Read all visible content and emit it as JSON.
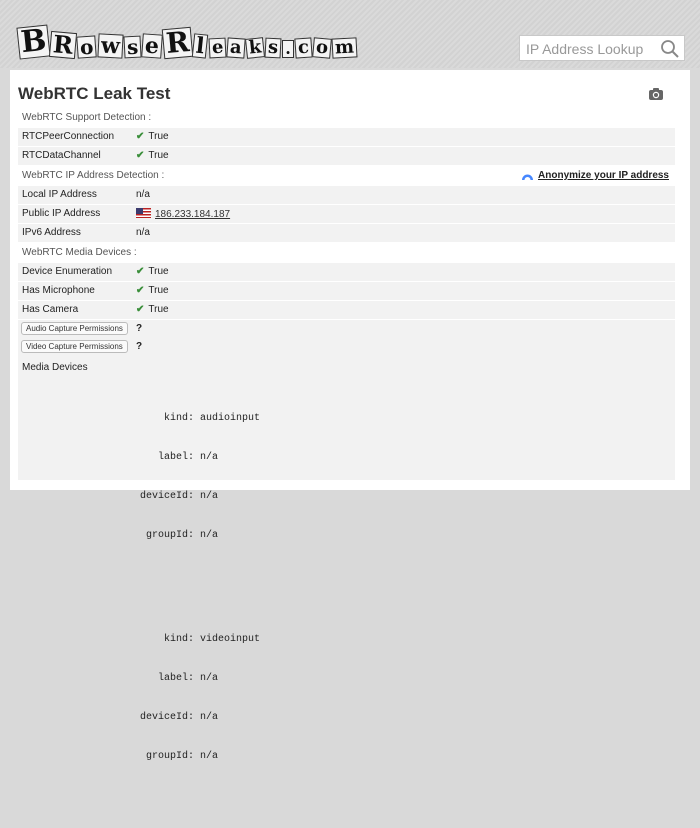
{
  "header": {
    "logo_letters": [
      "B",
      "R",
      "o",
      "w",
      "s",
      "e",
      "R",
      "l",
      "e",
      "a",
      "k",
      "s",
      ".",
      "c",
      "o",
      "m"
    ],
    "search_placeholder": "IP Address Lookup"
  },
  "main": {
    "title": "WebRTC Leak Test",
    "sections": {
      "support": "WebRTC Support Detection :",
      "ip": "WebRTC IP Address Detection :",
      "media": "WebRTC Media Devices :"
    },
    "anonymize_label": "Anonymize your IP address",
    "rows": {
      "peer": {
        "label": "RTCPeerConnection",
        "value": "True"
      },
      "datachannel": {
        "label": "RTCDataChannel",
        "value": "True"
      },
      "local_ip": {
        "label": "Local IP Address",
        "value": "n/a"
      },
      "public_ip": {
        "label": "Public IP Address",
        "value": "186.233.184.187"
      },
      "ipv6": {
        "label": "IPv6 Address",
        "value": "n/a"
      },
      "enumeration": {
        "label": "Device Enumeration",
        "value": "True"
      },
      "microphone": {
        "label": "Has Microphone",
        "value": "True"
      },
      "camera": {
        "label": "Has Camera",
        "value": "True"
      },
      "audio_perm": {
        "label": "Audio Capture Permissions",
        "value": "?"
      },
      "video_perm": {
        "label": "Video Capture Permissions",
        "value": "?"
      }
    },
    "media_devices": {
      "label": "Media Devices",
      "devices": [
        {
          "kind": "audioinput",
          "label": "n/a",
          "deviceId": "n/a",
          "groupId": "n/a"
        },
        {
          "kind": "videoinput",
          "label": "n/a",
          "deviceId": "n/a",
          "groupId": "n/a"
        }
      ],
      "keys": {
        "kind": "kind:",
        "label": "label:",
        "deviceId": "deviceId:",
        "groupId": "groupId:"
      }
    }
  },
  "colors": {
    "check": "#3a8e3a",
    "question": "#c0262c",
    "row_bg": "#f2f2f2"
  },
  "icons": {
    "search": "search-icon",
    "camera": "camera-icon",
    "check": "check-icon",
    "flag": "us-flag-icon",
    "anonymize": "vpn-icon"
  }
}
